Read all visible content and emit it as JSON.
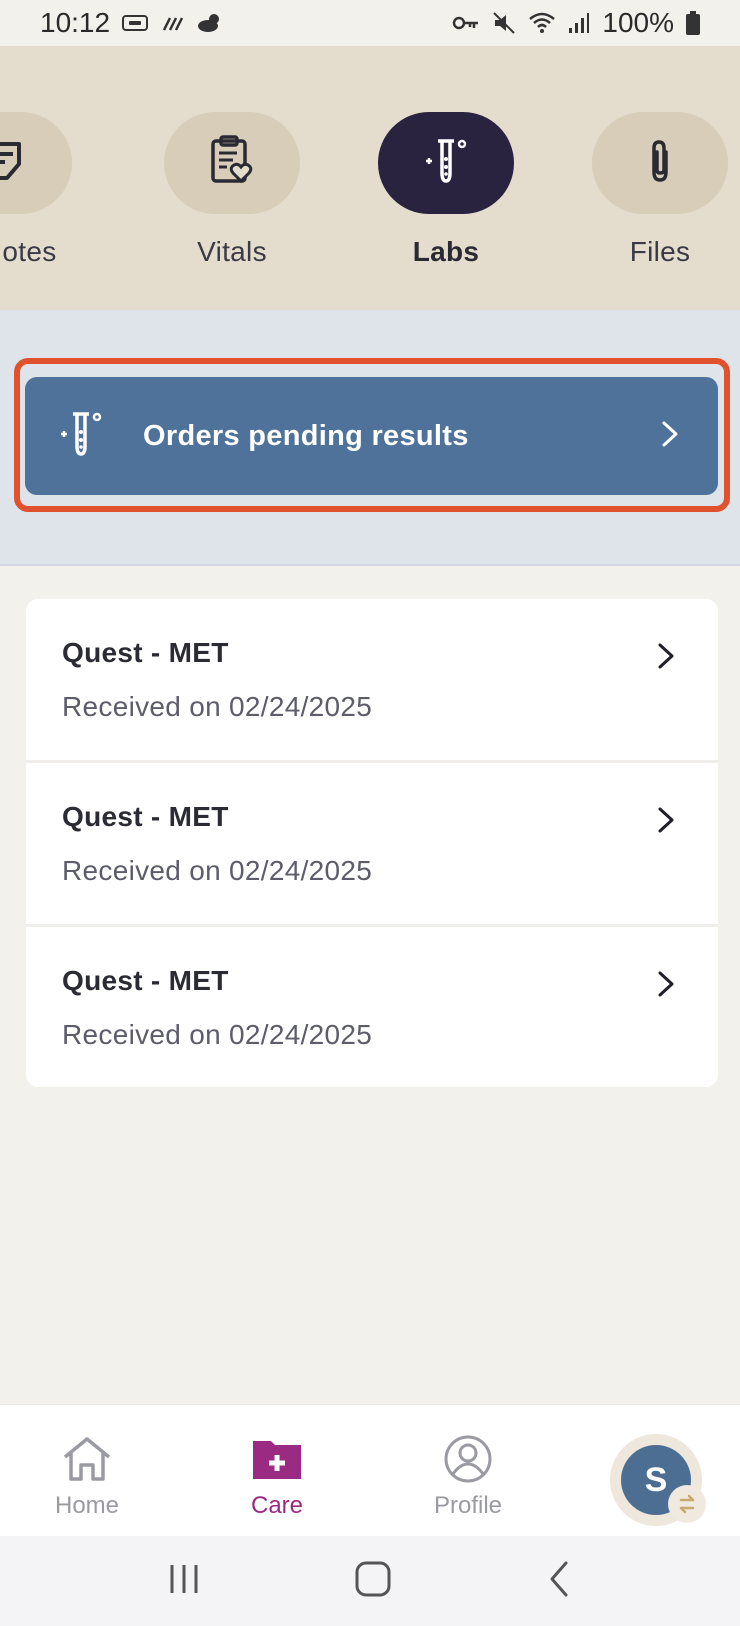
{
  "status_bar": {
    "time": "10:12",
    "battery": "100%"
  },
  "categories": [
    {
      "label": "al Notes",
      "icon": "notes-icon",
      "active": false
    },
    {
      "label": "Vitals",
      "icon": "clipboard-heart-icon",
      "active": false
    },
    {
      "label": "Labs",
      "icon": "test-tube-icon",
      "active": true
    },
    {
      "label": "Files",
      "icon": "paperclip-icon",
      "active": false
    }
  ],
  "banner": {
    "label": "Orders pending results"
  },
  "results": [
    {
      "title": "Quest - MET",
      "subtitle": "Received on 02/24/2025"
    },
    {
      "title": "Quest - MET",
      "subtitle": "Received on 02/24/2025"
    },
    {
      "title": "Quest - MET",
      "subtitle": "Received on 02/24/2025"
    }
  ],
  "bottom_nav": {
    "home": "Home",
    "care": "Care",
    "profile": "Profile",
    "avatar_initial": "S"
  },
  "colors": {
    "accent_active": "#9b2a83",
    "banner": "#4e7299",
    "highlight": "#e0512d",
    "active_pill": "#2a2340"
  }
}
